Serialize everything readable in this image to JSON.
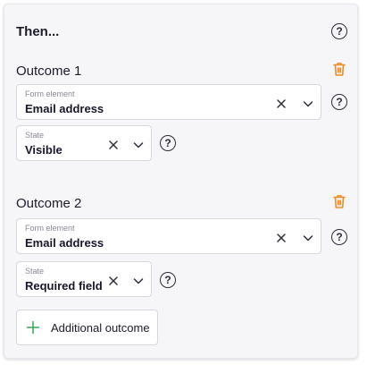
{
  "panel": {
    "title": "Then...",
    "outcomes": [
      {
        "title": "Outcome 1",
        "form_element": {
          "label": "Form element",
          "value": "Email address"
        },
        "state": {
          "label": "State",
          "value": "Visible"
        }
      },
      {
        "title": "Outcome 2",
        "form_element": {
          "label": "Form element",
          "value": "Email address"
        },
        "state": {
          "label": "State",
          "value": "Required field"
        }
      }
    ],
    "add_button_label": "Additional outcome"
  },
  "icons": {
    "help": "help-circle-icon",
    "delete": "trash-icon",
    "clear": "close-icon",
    "expand": "chevron-down-icon",
    "add": "plus-icon"
  },
  "colors": {
    "accent_orange": "#f08a24",
    "add_green": "#3aa655",
    "text_dark": "#1c1c2b",
    "field_label": "#8a8a99",
    "panel_bg": "#f6f6f9"
  }
}
